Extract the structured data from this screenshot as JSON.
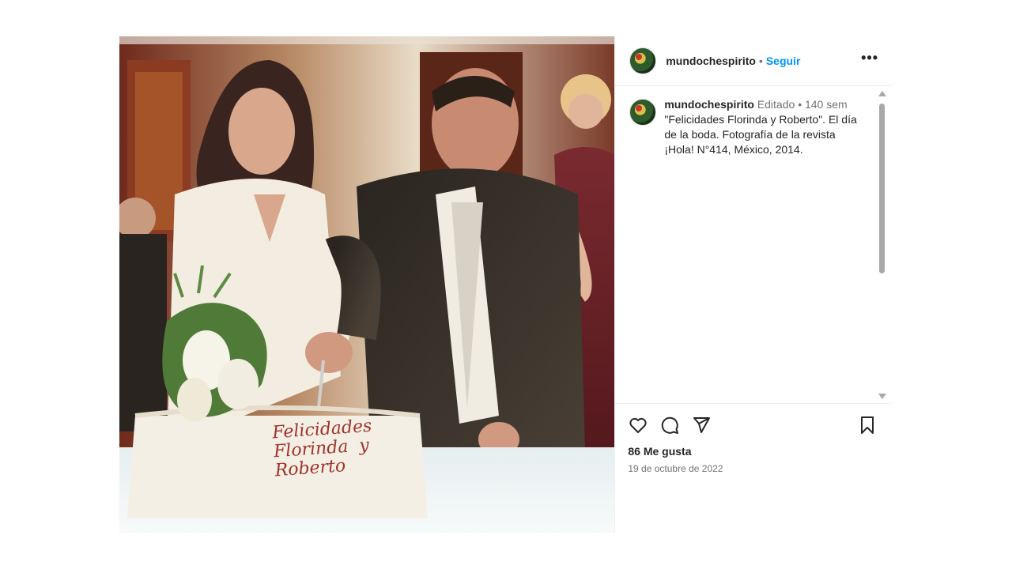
{
  "post": {
    "username": "mundochespirito",
    "follow_label": "Seguir",
    "more_label": "•••",
    "photo": {
      "description_icon": "wedding-photo",
      "cake_text": "Felicidades\nFlorinda  y\nRoberto"
    },
    "caption": {
      "username": "mundochespirito",
      "edited_label": "Editado",
      "age": "140 sem",
      "text": "\"Felicidades Florinda y Roberto\". El día de la boda. Fotografía de la revista ¡Hola! N°414, México, 2014."
    },
    "actions": {
      "like_icon": "heart-icon",
      "comment_icon": "comment-icon",
      "share_icon": "share-icon",
      "save_icon": "bookmark-icon"
    },
    "likes_label": "86 Me gusta",
    "date_label": "19 de octubre de 2022"
  },
  "colors": {
    "follow": "#0095f6",
    "text": "#262626",
    "muted": "#737373"
  }
}
